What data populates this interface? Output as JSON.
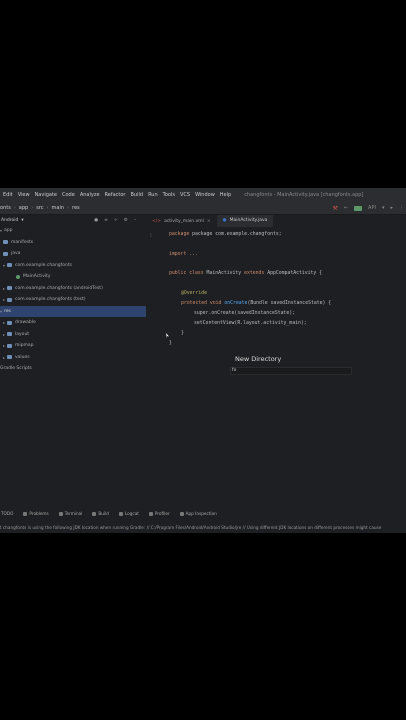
{
  "menubar": {
    "items": [
      "Edit",
      "View",
      "Navigate",
      "Code",
      "Analyze",
      "Refactor",
      "Build",
      "Run",
      "Tools",
      "VCS",
      "Window",
      "Help"
    ],
    "title": "changfonts - MainActivity.java [changfonts.app]"
  },
  "navbar": {
    "crumbs": [
      "onts",
      "app",
      "src",
      "main",
      "res"
    ],
    "device_label": "API",
    "colors": {
      "run": "#5b9a68",
      "hammer": "#c75450"
    }
  },
  "project": {
    "view_label": "Android",
    "items": [
      {
        "label": "app",
        "indent": 0,
        "icon": "folder-icon"
      },
      {
        "label": "manifests",
        "indent": 1,
        "icon": "folder-icon"
      },
      {
        "label": "java",
        "indent": 1,
        "icon": "folder-icon"
      },
      {
        "label": "com.example.changfonts",
        "indent": 2,
        "icon": "package-icon"
      },
      {
        "label": "MainActivity",
        "indent": 3,
        "icon": "class-icon"
      },
      {
        "label": "com.example.changfonts (androidTest)",
        "indent": 2,
        "icon": "package-icon"
      },
      {
        "label": "com.example.changfonts (test)",
        "indent": 2,
        "icon": "package-icon"
      },
      {
        "label": "res",
        "indent": 0,
        "icon": "folder-icon",
        "selected": true
      },
      {
        "label": "drawable",
        "indent": 2,
        "icon": "folder-icon"
      },
      {
        "label": "layout",
        "indent": 2,
        "icon": "folder-icon"
      },
      {
        "label": "mipmap",
        "indent": 2,
        "icon": "folder-icon"
      },
      {
        "label": "values",
        "indent": 2,
        "icon": "folder-icon"
      },
      {
        "label": "Gradle Scripts",
        "indent": 0,
        "icon": "gradle-icon"
      }
    ]
  },
  "tabs": [
    {
      "label": "activity_main.xml",
      "active": false
    },
    {
      "label": "MainActivity.java",
      "active": true
    }
  ],
  "code": {
    "line1": "package com.example.changfonts;",
    "line2": "import ...",
    "line3_kw": "public class",
    "line3_rest": " MainActivity ",
    "line3_kw2": "extends",
    "line3_cls": " AppCompatActivity {",
    "line4": "@Override",
    "line5_kw": "protected void",
    "line5_fn": " onCreate",
    "line5_rest": "(Bundle savedInstanceState) {",
    "line6": "super.onCreate(savedInstanceState);",
    "line7": "setContentView(R.layout.activity_main);",
    "line8": "}",
    "line9": "}"
  },
  "dialog": {
    "title": "New Directory",
    "input_value": "fo"
  },
  "bottombar": {
    "items": [
      "TODO",
      "Problems",
      "Terminal",
      "Build",
      "Logcat",
      "Profiler",
      "App Inspection"
    ]
  },
  "status": "t changfonts is using the following JDK location when running Gradle: // C:/Program Files/Android/Android Studio/jre // Using different JDK locations on different processes might cause"
}
